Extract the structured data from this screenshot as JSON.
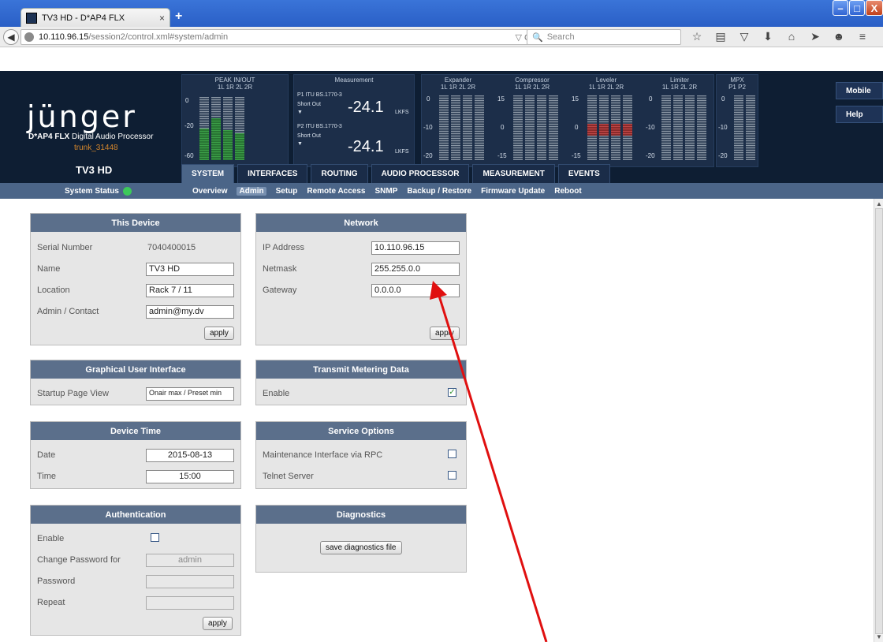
{
  "browser": {
    "tab_title": "TV3 HD - D*AP4 FLX",
    "tab_close": "×",
    "new_tab": "+",
    "url_host": "10.110.96.15",
    "url_path": "/session2/control.xml#system/admin",
    "search_placeholder": "Search",
    "window_controls": {
      "minimize": "–",
      "maximize": "□",
      "close": "X"
    }
  },
  "device": {
    "logo": "jünger",
    "product_bold": "D*AP4 FLX",
    "product_rest": " Digital Audio Processor",
    "build": "trunk_31448",
    "name": "TV3 HD"
  },
  "meters": {
    "peak": {
      "title": "PEAK IN/OUT",
      "channels": "1L   1R   2L   2R",
      "scale": [
        "0",
        "-20",
        "-60"
      ],
      "levels": [
        0.5,
        0.66,
        0.48,
        0.42
      ],
      "fill": "green"
    },
    "measurement": {
      "title": "Measurement",
      "p1_label": "P1 ITU BS.1770-3",
      "p1_mode": "Short Out",
      "p1_value": "-24.1",
      "p1_unit": "LKFS",
      "p2_label": "P2 ITU BS.1770-3",
      "p2_mode": "Short Out",
      "p2_value": "-24.1",
      "p2_unit": "LKFS",
      "arrow": "▼"
    },
    "expander": {
      "title": "Expander",
      "channels": "1L  1R  2L  2R",
      "scale": [
        "0",
        "-10",
        "-20"
      ],
      "levels": [
        0,
        0,
        0,
        0
      ]
    },
    "compressor": {
      "title": "Compressor",
      "channels": "1L  1R  2L  2R",
      "scale": [
        "15",
        "0",
        "-15"
      ],
      "levels": [
        0,
        0,
        0,
        0
      ]
    },
    "leveler": {
      "title": "Leveler",
      "channels": "1L  1R  2L  2R",
      "scale": [
        "15",
        "0",
        "-15"
      ],
      "levels": [
        0.18,
        0.18,
        0.18,
        0.18
      ],
      "fill": "red"
    },
    "limiter": {
      "title": "Limiter",
      "channels": "1L  1R  2L  2R",
      "scale": [
        "0",
        "-10",
        "-20"
      ],
      "levels": [
        0,
        0,
        0,
        0
      ]
    },
    "mpx": {
      "title": "MPX",
      "channels": "P1  P2",
      "scale": [
        "0",
        "-10",
        "-20"
      ],
      "levels": [
        0,
        0
      ]
    }
  },
  "side_buttons": {
    "mobile": "Mobile",
    "help": "Help"
  },
  "main_tabs": [
    "SYSTEM",
    "INTERFACES",
    "ROUTING",
    "AUDIO PROCESSOR",
    "MEASUREMENT",
    "EVENTS"
  ],
  "subnav": {
    "status_label": "System Status",
    "items": [
      "Overview",
      "Admin",
      "Setup",
      "Remote Access",
      "SNMP",
      "Backup / Restore",
      "Firmware Update",
      "Reboot"
    ]
  },
  "this_device": {
    "title": "This Device",
    "serial_label": "Serial Number",
    "serial_value": "7040400015",
    "name_label": "Name",
    "name_value": "TV3 HD",
    "location_label": "Location",
    "location_value": "Rack 7 / 11",
    "contact_label": "Admin / Contact",
    "contact_value": "admin@my.dv",
    "apply": "apply"
  },
  "network": {
    "title": "Network",
    "ip_label": "IP Address",
    "ip_value": "10.110.96.15",
    "netmask_label": "Netmask",
    "netmask_value": "255.255.0.0",
    "gateway_label": "Gateway",
    "gateway_value": "0.0.0.0",
    "apply": "apply"
  },
  "gui": {
    "title": "Graphical User Interface",
    "startup_label": "Startup Page View",
    "startup_value": "Onair max / Preset min"
  },
  "metering": {
    "title": "Transmit Metering Data",
    "enable_label": "Enable",
    "checked": "✓"
  },
  "device_time": {
    "title": "Device Time",
    "date_label": "Date",
    "date_value": "2015-08-13",
    "time_label": "Time",
    "time_value": "15:00"
  },
  "service": {
    "title": "Service Options",
    "rpc_label": "Maintenance Interface via RPC",
    "telnet_label": "Telnet Server"
  },
  "auth": {
    "title": "Authentication",
    "enable_label": "Enable",
    "change_label": "Change Password for",
    "change_value": "admin",
    "password_label": "Password",
    "repeat_label": "Repeat",
    "apply": "apply"
  },
  "diagnostics": {
    "title": "Diagnostics",
    "button": "save diagnostics file"
  },
  "annotation": {
    "color": "#e01010"
  }
}
